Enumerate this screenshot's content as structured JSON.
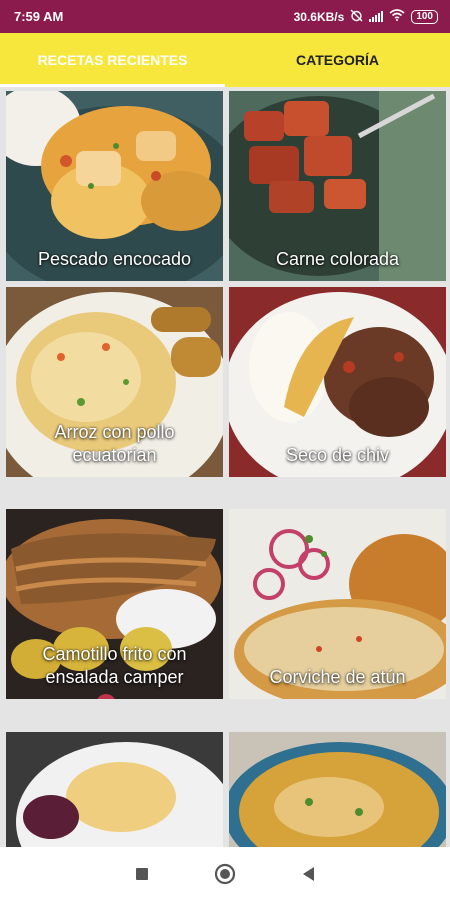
{
  "status_bar": {
    "time": "7:59 AM",
    "network_speed": "30.6KB/s",
    "battery": "100",
    "icons": [
      "alarm-off-icon",
      "signal-icon",
      "wifi-icon",
      "battery-icon"
    ]
  },
  "tabs": [
    {
      "label": "RECETAS RECIENTES",
      "active": false
    },
    {
      "label": "CATEGORÍA",
      "active": true
    }
  ],
  "recipes": [
    {
      "title": "Pescado encocado"
    },
    {
      "title": "Carne colorada"
    },
    {
      "title": "Arroz con pollo ecuatorian"
    },
    {
      "title": "Seco de chiv"
    },
    {
      "title": "Camotillo frito con ensalada camper"
    },
    {
      "title": "Corviche de atún"
    },
    {
      "title": ""
    },
    {
      "title": ""
    }
  ],
  "nav_bar": {
    "buttons": [
      "recents-square-icon",
      "home-circle-icon",
      "back-triangle-icon"
    ]
  },
  "colors": {
    "status_bar": "#8a1b4c",
    "tab_bar": "#f7e63c",
    "grid_background": "#e4e4e4"
  }
}
